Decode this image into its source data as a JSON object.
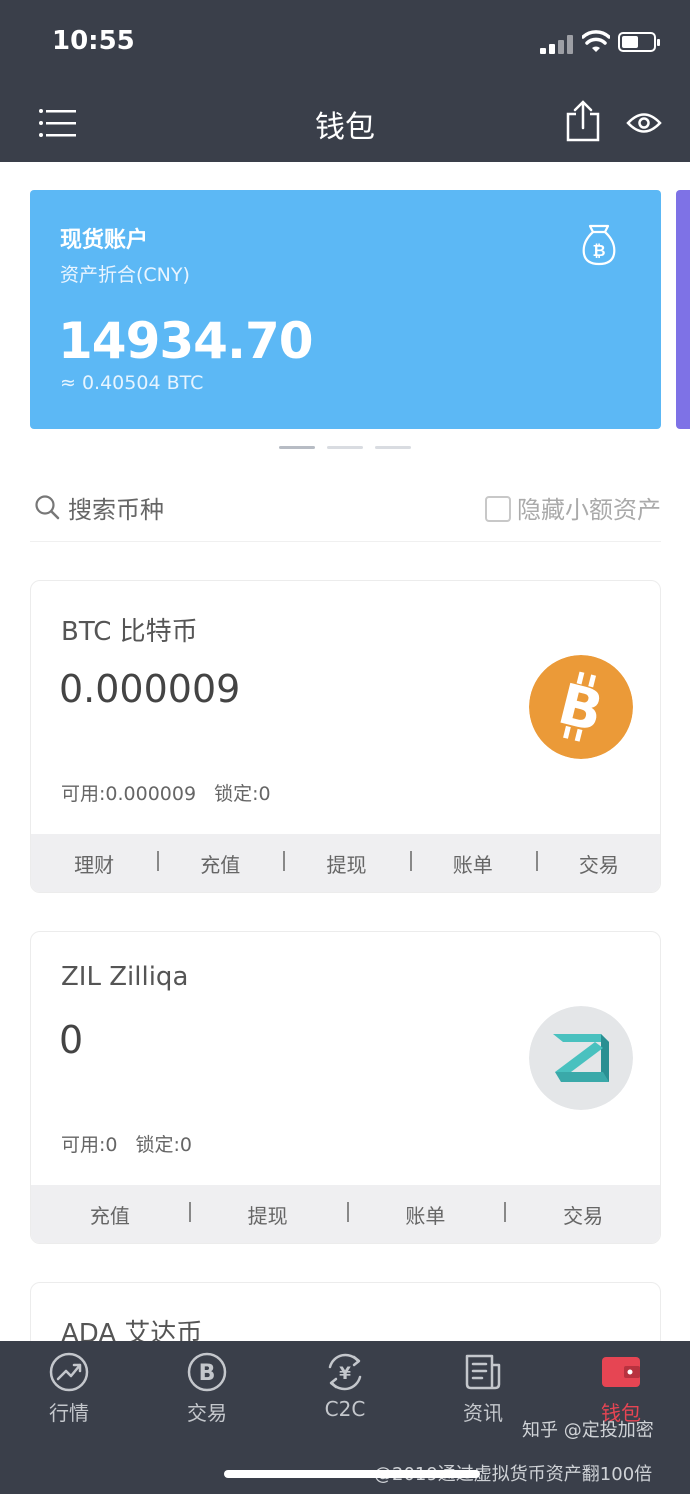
{
  "status_bar": {
    "time": "10:55"
  },
  "nav": {
    "title": "钱包"
  },
  "asset_card": {
    "title": "现货账户",
    "subtitle": "资产折合(CNY)",
    "amount": "14934.70",
    "btc_equiv": "≈ 0.40504 BTC",
    "color": "#5cb8f5"
  },
  "carousel": {
    "pages": 3,
    "active": 0
  },
  "search": {
    "label": "搜索币种",
    "hide_small_label": "隐藏小额资产",
    "hide_small_checked": false
  },
  "coins": [
    {
      "name": "BTC 比特币",
      "balance": "0.000009",
      "available": "可用:0.000009",
      "locked": "锁定:0",
      "icon": "bitcoin-icon",
      "actions": [
        "理财",
        "充值",
        "提现",
        "账单",
        "交易"
      ]
    },
    {
      "name": "ZIL Zilliqa",
      "balance": "0",
      "available": "可用:0",
      "locked": "锁定:0",
      "icon": "zilliqa-icon",
      "actions": [
        "充值",
        "提现",
        "账单",
        "交易"
      ]
    },
    {
      "name": "ADA 艾达币"
    }
  ],
  "tabbar": {
    "items": [
      {
        "label": "行情",
        "icon": "trend-icon"
      },
      {
        "label": "交易",
        "icon": "bitcoin-circle-icon"
      },
      {
        "label": "C2C",
        "icon": "yen-exchange-icon"
      },
      {
        "label": "资讯",
        "icon": "news-icon"
      },
      {
        "label": "钱包",
        "icon": "wallet-icon",
        "active": true
      }
    ],
    "active_color": "#e64553"
  },
  "watermark": {
    "line1": "知乎 @定投加密",
    "line2": "@2019通过虚拟货币资产翻100倍"
  }
}
